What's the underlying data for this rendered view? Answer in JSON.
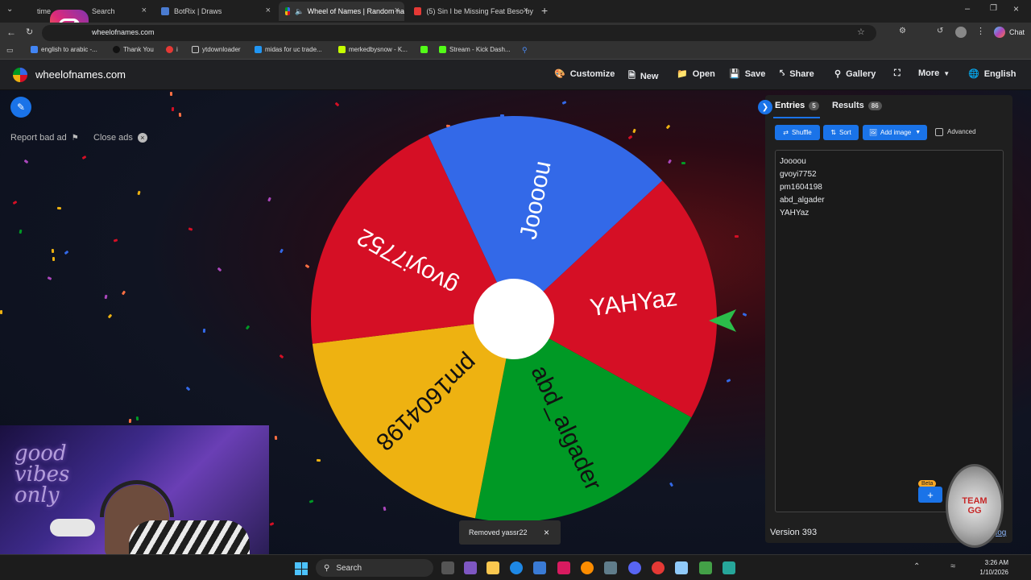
{
  "browser": {
    "tabs": [
      {
        "label": "time",
        "active": false
      },
      {
        "label": "Search",
        "active": false
      },
      {
        "label": "BotRix | Draws",
        "active": false
      },
      {
        "label": "Wheel of Names | Random na",
        "active": true
      },
      {
        "label": "(5) Sin I be Missing Feat Beso by",
        "active": false
      }
    ],
    "address": "wheelofnames.com",
    "chat_label": "Chat",
    "bookmarks": [
      "english to arabic -...",
      "Thank You",
      "i",
      "ytdownloader",
      "midas for uc trade...",
      "merkedbysnow - K...",
      "Stream - Kick Dash..."
    ]
  },
  "site": {
    "logo_text": "wheelofnames.com",
    "menu": {
      "customize": "Customize",
      "new": "New",
      "open": "Open",
      "save": "Save",
      "share": "Share",
      "gallery": "Gallery",
      "more": "More",
      "language": "English"
    }
  },
  "ads": {
    "report": "Report bad ad",
    "close": "Close ads"
  },
  "wheel": {
    "segments": [
      {
        "label": "Joooou",
        "color": "#3369e8"
      },
      {
        "label": "YAHYaz",
        "color": "#d50f25"
      },
      {
        "label": "abd_algader",
        "color": "#009925"
      },
      {
        "label": "pm1604198",
        "color": "#eeb211"
      },
      {
        "label": "gvoyi7752",
        "color": "#d50f25"
      }
    ]
  },
  "panel": {
    "tab_entries": "Entries",
    "entries_count": "5",
    "tab_results": "Results",
    "results_count": "86",
    "shuffle": "Shuffle",
    "sort": "Sort",
    "add_image": "Add image",
    "advanced": "Advanced",
    "entries": [
      "Joooou",
      "gvoyi7752",
      "pm1604198",
      "abd_algader",
      "YAHYaz"
    ],
    "beta_label": "Beta",
    "version": "Version 393",
    "changelog": "log"
  },
  "toast": {
    "text": "Removed yassr22"
  },
  "taskbar": {
    "search": "Search",
    "time": "3:26 AM",
    "date": "1/10/2026"
  },
  "overlay": {
    "neon_text": "good vibes only",
    "badge_text": "TEAM GG"
  },
  "colors": {
    "accent": "#1a73e8",
    "wheel_blue": "#3369e8",
    "wheel_red": "#d50f25",
    "wheel_green": "#009925",
    "wheel_yellow": "#eeb211"
  }
}
